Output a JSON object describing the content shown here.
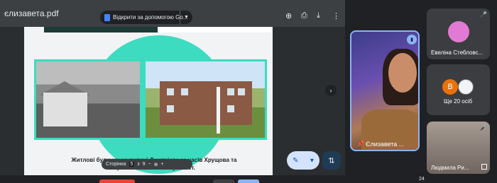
{
  "pdf": {
    "filename": "єлизавета.pdf",
    "open_with_label": "Відкрити за допомогою Go...",
    "caption": "Житлові будинки на вулиці Дмитрієва за часів Хрущова та Брежнєва і на початку XXI ст.",
    "page_control": {
      "label": "Сторінка",
      "current": "5",
      "separator": "з",
      "total": "9",
      "minus": "−",
      "plus": "+"
    }
  },
  "participants": {
    "main": {
      "name": "Єлизавета ..."
    },
    "tile1": {
      "name": "Евеліна Стебловс..."
    },
    "more": {
      "initial": "В",
      "label": "Ще 20 осіб"
    },
    "tile3": {
      "name": "Людмила Ри..."
    }
  },
  "bottom_badge": "24",
  "colors": {
    "accent": "#3ddbc0",
    "active_border": "#8ab4f8",
    "fab_bg": "#d3e3fd"
  }
}
